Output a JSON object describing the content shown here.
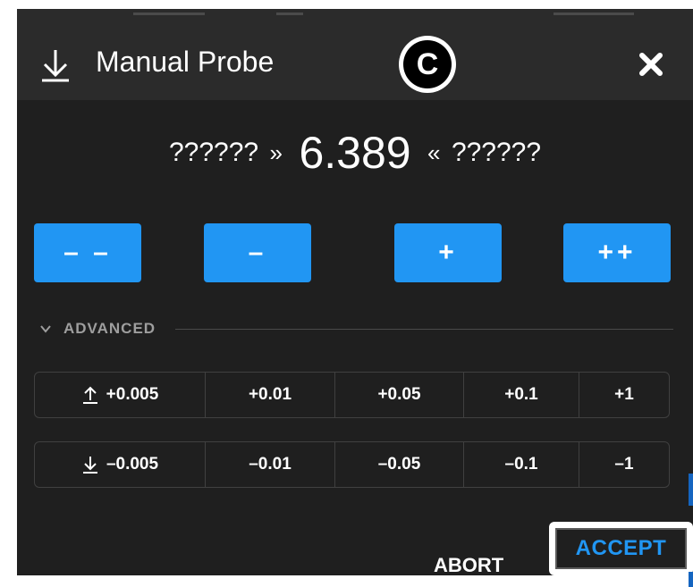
{
  "dialog": {
    "title": "Manual Probe",
    "badge_letter": "C",
    "close_icon": "close-icon"
  },
  "readout": {
    "left_text": "??????",
    "left_chevron": "»",
    "value": "6.389",
    "right_chevron": "«",
    "right_text": "??????"
  },
  "step_buttons": {
    "coarse_down": "– –",
    "fine_down": "–",
    "fine_up": "+",
    "coarse_up": "++"
  },
  "advanced": {
    "label": "ADVANCED"
  },
  "offsets_up": [
    "+0.005",
    "+0.01",
    "+0.05",
    "+0.1",
    "+1"
  ],
  "offsets_down": [
    "–0.005",
    "–0.01",
    "–0.05",
    "–0.1",
    "–1"
  ],
  "actions": {
    "abort": "ABORT",
    "accept": "ACCEPT"
  },
  "colors": {
    "accent": "#2196f3",
    "panel": "#1f1f1f",
    "header": "#2b2b2b"
  }
}
